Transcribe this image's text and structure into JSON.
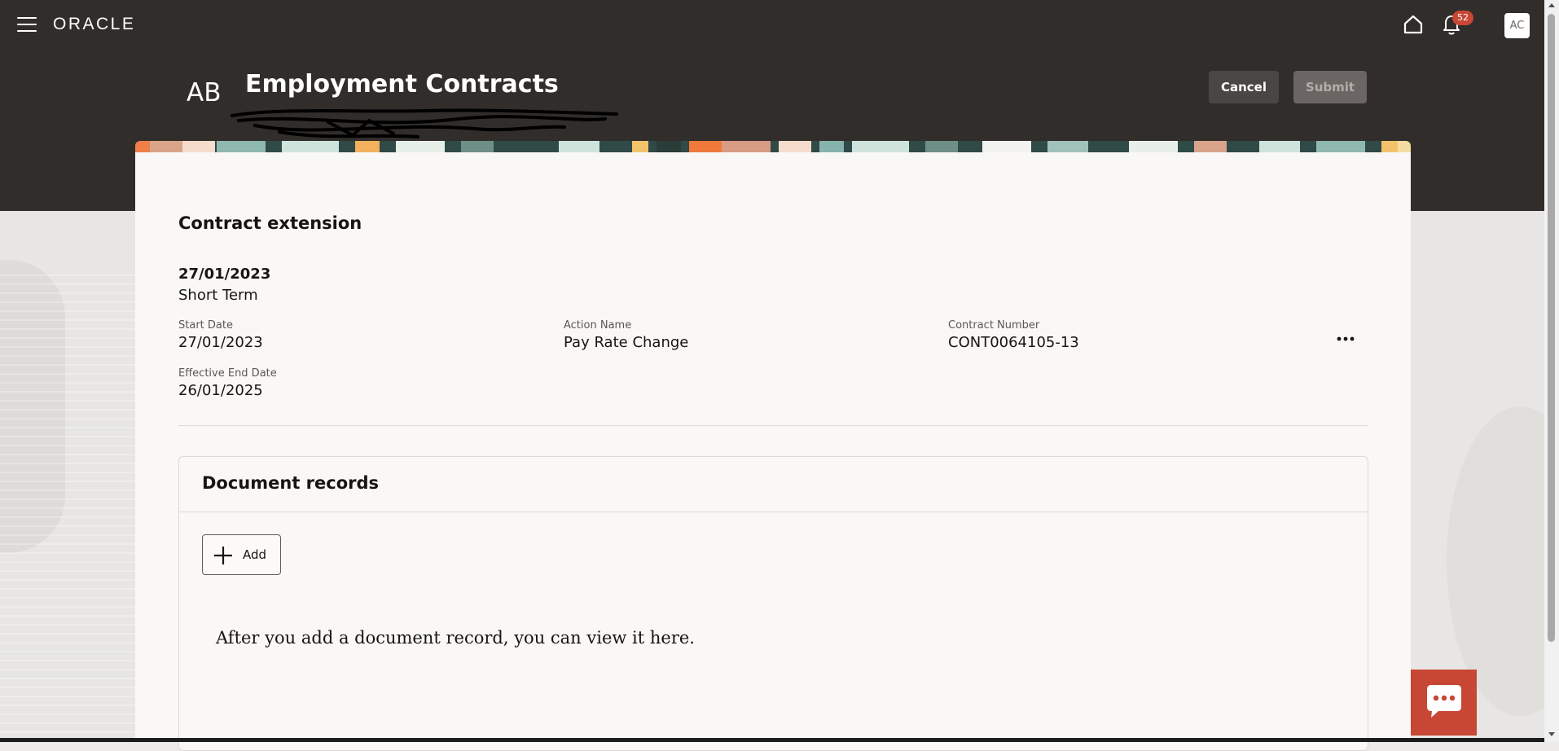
{
  "topbar": {
    "logo": "ORACLE",
    "notification_count": "52",
    "user_initials": "AC"
  },
  "page": {
    "initials": "AB",
    "title": "Employment Contracts",
    "cancel_label": "Cancel",
    "submit_label": "Submit"
  },
  "contract": {
    "section_title": "Contract extension",
    "summary_date": "27/01/2023",
    "summary_type": "Short Term",
    "fields": [
      {
        "label": "Start Date",
        "value": "27/01/2023"
      },
      {
        "label": "Action Name",
        "value": "Pay Rate Change"
      },
      {
        "label": "Contract Number",
        "value": "CONT0064105-13"
      },
      {
        "label": "Effective End Date",
        "value": "26/01/2025"
      }
    ]
  },
  "documents": {
    "title": "Document records",
    "add_label": "Add",
    "empty_message": "After you add a document record, you can view it here."
  },
  "colors": {
    "header": "#312d2a",
    "accent_red": "#c74634",
    "card": "#f9f8f6"
  },
  "icons": [
    "hamburger-icon",
    "home-icon",
    "bell-icon",
    "more-icon",
    "plus-icon",
    "chat-icon"
  ]
}
